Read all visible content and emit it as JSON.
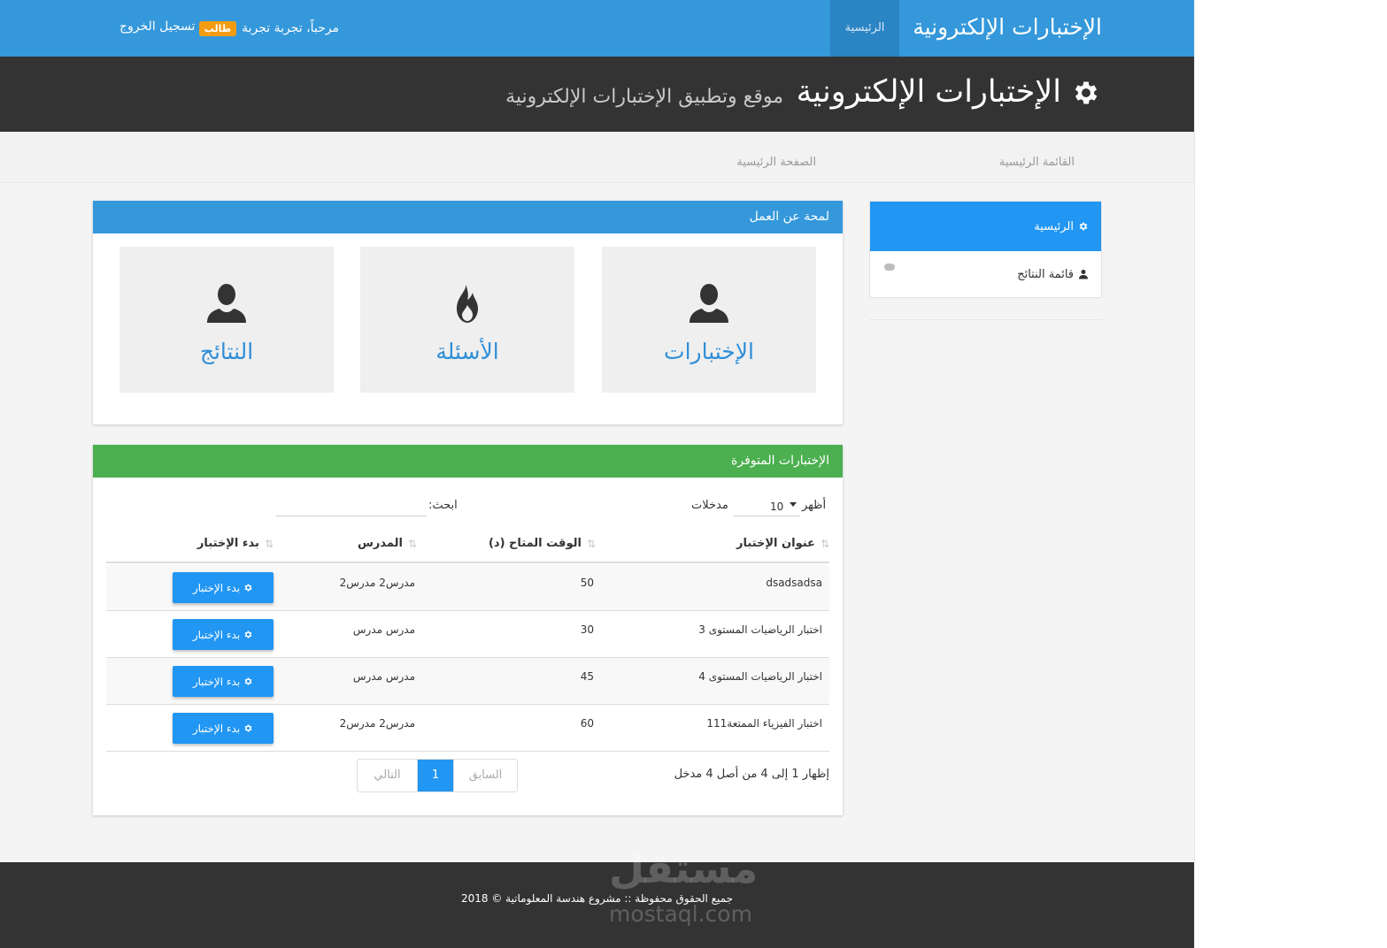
{
  "topbar": {
    "brand": "الإختبارات الإلكترونية",
    "home": "الرئيسية",
    "welcome": "مرحباً، تجربة تجربة",
    "role_badge": "طالب",
    "logout": "تسجيل الخروج",
    "bg": "#3498db"
  },
  "header": {
    "title": "الإختبارات الإلكترونية",
    "subtitle": "موقع وتطبيق الإختبارات الإلكترونية",
    "icon": "gear-icon"
  },
  "breadcrumb": {
    "main_menu": "القائمة الرئيسية",
    "home_page": "الصفحة الرئيسية"
  },
  "sidebar": {
    "items": [
      {
        "label": "الرئيسية",
        "icon": "gear-icon",
        "active": true
      },
      {
        "label": "قائمة النتائج",
        "icon": "user-icon",
        "active": false
      }
    ]
  },
  "overview": {
    "title": "لمحة عن العمل",
    "tiles": [
      {
        "label": "الإختبارات",
        "icon": "user-icon"
      },
      {
        "label": "الأسئلة",
        "icon": "fire-icon"
      },
      {
        "label": "النتائج",
        "icon": "user-icon"
      }
    ]
  },
  "exams": {
    "title": "الإختبارات المتوفرة",
    "show_label": "أظهر",
    "page_size": "10",
    "entries_label": "مدخلات",
    "search_label": "ابحث:",
    "search_value": "",
    "columns": {
      "title": "عنوان الإختبار",
      "time": "الوقت المتاح (د)",
      "teacher": "المدرس",
      "action": "بدء الإختبار"
    },
    "rows": [
      {
        "title": "dsadsadsa",
        "time": "50",
        "teacher": "مدرس2 مدرس2",
        "action": "بدء الإختبار"
      },
      {
        "title": "اختبار الرياضيات المستوى 3",
        "time": "30",
        "teacher": "مدرس مدرس",
        "action": "بدء الإختبار"
      },
      {
        "title": "اختبار الرياضيات المستوى 4",
        "time": "45",
        "teacher": "مدرس مدرس",
        "action": "بدء الإختبار"
      },
      {
        "title": "اختبار الفيزياء الممتعة111",
        "time": "60",
        "teacher": "مدرس2 مدرس2",
        "action": "بدء الإختبار"
      }
    ],
    "info": "إظهار 1 إلى 4 من أصل 4 مدخل",
    "pager": {
      "prev": "السابق",
      "current": "1",
      "next": "التالي"
    }
  },
  "footer": {
    "text": "جميع الحقوق محفوظة :: مشروع هندسة المعلوماتية © 2018",
    "watermark_ar": "مستقل",
    "watermark_en": "mostaql.com"
  }
}
